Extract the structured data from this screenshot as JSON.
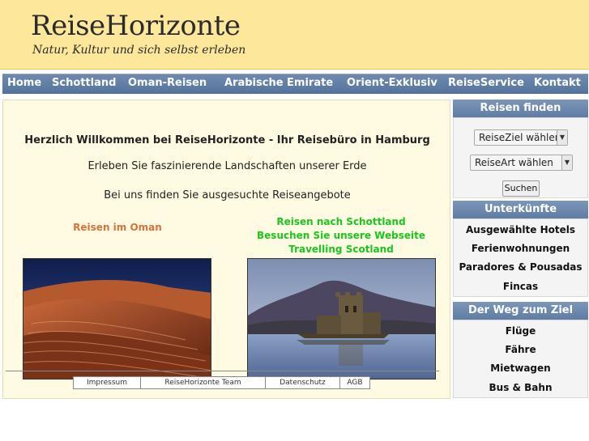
{
  "header": {
    "title": "ReiseHorizonte",
    "tagline": "Natur, Kultur und sich selbst erleben"
  },
  "nav": {
    "items": [
      "Home",
      "Schottland",
      "Oman-Reisen",
      "Arabische Emirate",
      "Orient-Exklusiv",
      "ReiseService",
      "Kontakt"
    ]
  },
  "main": {
    "welcome": "Herzlich Willkommen bei ReiseHorizonte - Ihr Reisebüro in Hamburg",
    "intro1": "Erleben Sie faszinierende Landschaften unserer Erde",
    "intro2": "Bei uns finden Sie ausgesuchte Reiseangebote",
    "oman_heading": "Reisen im Oman",
    "scotland_line1": "Reisen nach Schottland",
    "scotland_line2": "Besuchen Sie unsere Webseite Travelling Scotland"
  },
  "footer": {
    "links": [
      "Impressum",
      "ReiseHorizonte Team",
      "Datenschutz",
      "AGB"
    ]
  },
  "sidebar": {
    "search_heading": "Reisen finden",
    "select_destination": "ReiseZiel wählen",
    "select_type": "ReiseArt wählen",
    "search_button": "Suchen",
    "accommodation_heading": "Unterkünfte",
    "accommodation_items": [
      "Ausgewählte Hotels",
      "Ferienwohnungen",
      "Paradores & Pousadas",
      "Fincas"
    ],
    "travel_heading": "Der Weg zum Ziel",
    "travel_items": [
      "Flüge",
      "Fähre",
      "Mietwagen",
      "Bus & Bahn"
    ]
  },
  "colors": {
    "header_bg": "#fde79a",
    "nav_bg": "#5f7ca3",
    "main_bg": "#fffbe2",
    "oman_heading": "#d4733b",
    "scotland_link": "#19c61e"
  }
}
